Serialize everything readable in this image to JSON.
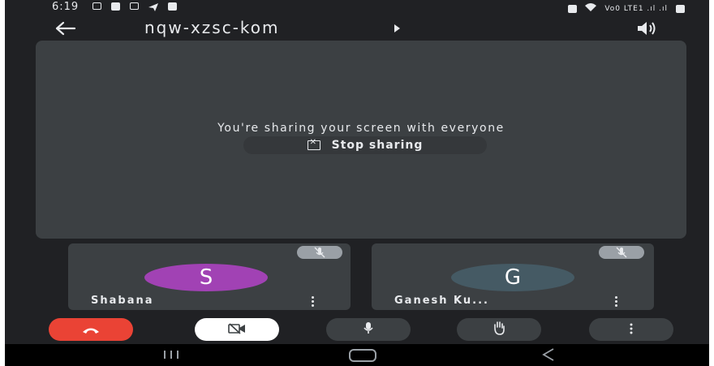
{
  "status_bar": {
    "time": "6:19",
    "signal_text": "Vo0 LTE1 .ıl .ıl",
    "icons": [
      "notification-icon",
      "alert-icon",
      "image-icon",
      "send-icon",
      "weather-icon",
      "alarm-icon",
      "wifi-icon",
      "signal-icon",
      "battery-icon"
    ]
  },
  "header": {
    "meeting_code": "nqw-xzsc-kom",
    "back_icon": "arrow-left-icon",
    "speaker_icon": "speaker-icon"
  },
  "stage": {
    "message": "You're sharing your screen with everyone",
    "stop_label": "Stop sharing"
  },
  "participants": [
    {
      "name": "Shabana",
      "initial": "S",
      "color": "#a142b4",
      "muted": true
    },
    {
      "name": "Ganesh Ku...",
      "initial": "G",
      "color": "#455a64",
      "muted": true
    }
  ],
  "controls": [
    {
      "name": "end-call",
      "icon": "phone-hangup-icon",
      "color": "#ea4335"
    },
    {
      "name": "camera-off",
      "icon": "videocam-off-icon",
      "color": "#ffffff"
    },
    {
      "name": "mic",
      "icon": "microphone-icon",
      "color": "#3c4043"
    },
    {
      "name": "raise-hand",
      "icon": "hand-icon",
      "color": "#3c4043"
    },
    {
      "name": "more",
      "icon": "more-vert-icon",
      "color": "#3c4043"
    }
  ],
  "nav": {
    "recent_icon": "recent-apps-icon",
    "home_icon": "home-icon",
    "back_icon": "nav-back-icon"
  }
}
